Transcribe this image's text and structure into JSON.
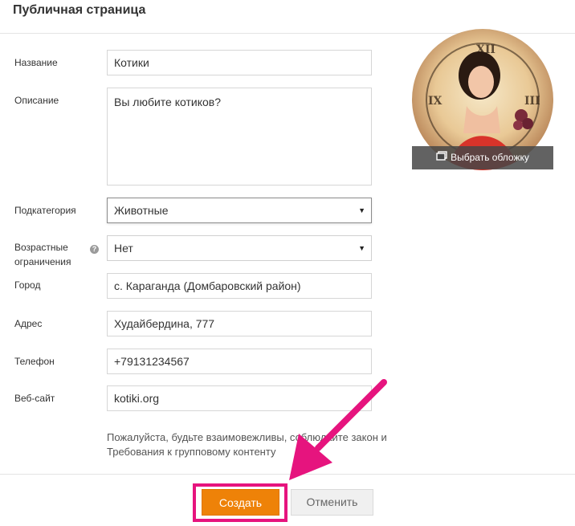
{
  "page": {
    "title": "Публичная страница"
  },
  "form": {
    "name": {
      "label": "Название",
      "value": "Котики"
    },
    "description": {
      "label": "Описание",
      "value": "Вы любите котиков?"
    },
    "subcategory": {
      "label": "Подкатегория",
      "value": "Животные"
    },
    "age": {
      "label_line1": "Возрастные",
      "label_line2": "ограничения",
      "value": "Нет"
    },
    "city": {
      "label": "Город",
      "value": "с. Караганда (Домбаровский район)"
    },
    "address": {
      "label": "Адрес",
      "value": "Худайбердина, 777"
    },
    "phone": {
      "label": "Телефон",
      "value": "+79131234567"
    },
    "website": {
      "label": "Веб-сайт",
      "value": "kotiki.org"
    }
  },
  "note": {
    "line1": "Пожалуйста, будьте взаимовежливы, соблюдайте закон и",
    "line2": "Требования к групповому контенту"
  },
  "cover": {
    "button_label": "Выбрать обложку"
  },
  "actions": {
    "create_label": "Создать",
    "cancel_label": "Отменить"
  },
  "colors": {
    "primary_button": "#ee8208",
    "annotation": "#e6147e"
  }
}
